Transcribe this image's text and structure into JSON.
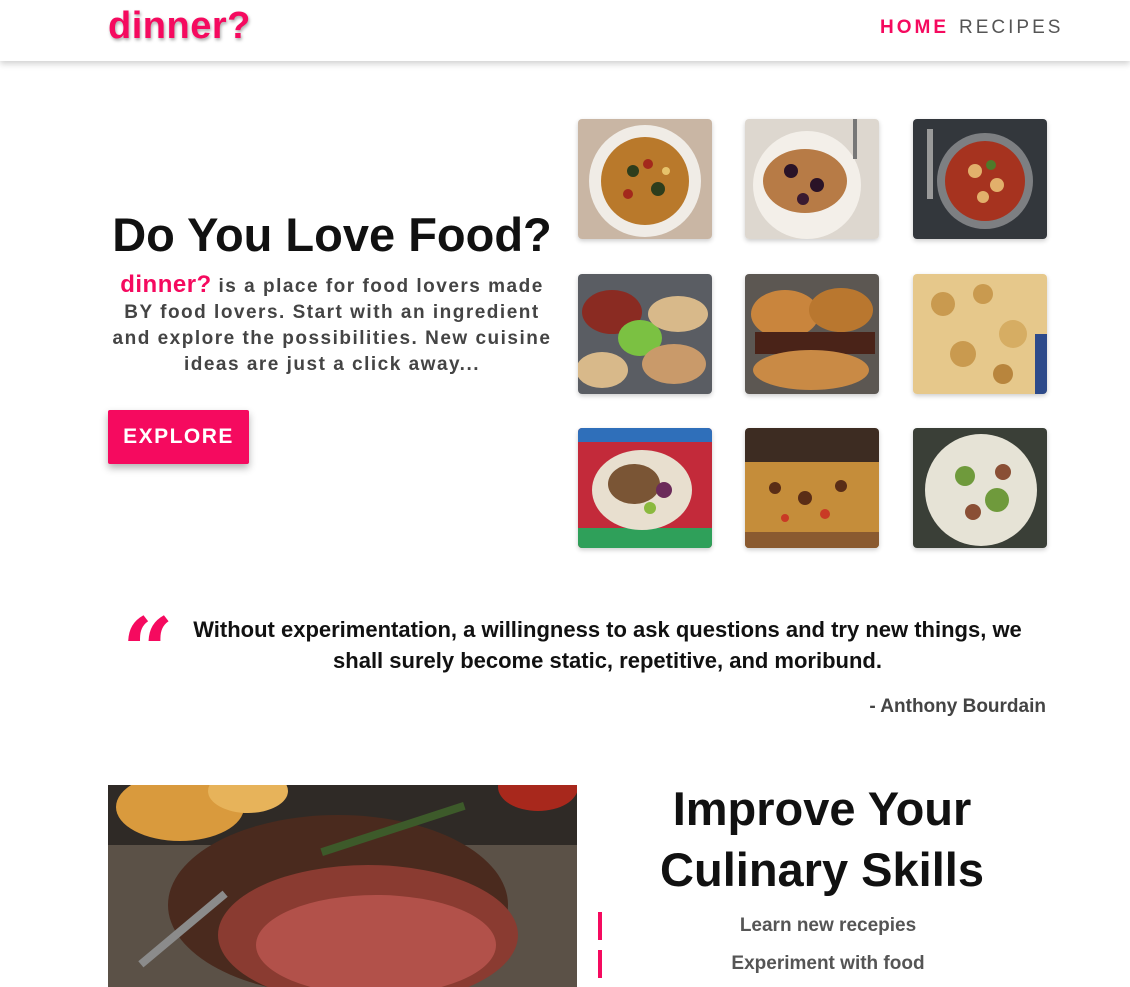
{
  "nav": {
    "brand": "dinner?",
    "links": [
      {
        "label": "HOME",
        "active": true
      },
      {
        "label": "RECIPES",
        "active": false
      }
    ]
  },
  "hero": {
    "title": "Do You Love Food?",
    "brand": "dinner?",
    "text": "is a place for food lovers made BY food lovers. Start with an ingredient and explore the possibilities. New cuisine ideas are just a click away...",
    "cta": "EXPLORE"
  },
  "quote": {
    "icon": "quote-icon",
    "text": "Without experimentation, a willingness to ask questions and try new things, we shall surely become static, repetitive, and moribund.",
    "author": "- Anthony Bourdain"
  },
  "skills": {
    "title": "Improve Your Culinary Skills",
    "items": [
      "Learn new recepies",
      "Experiment with food"
    ]
  },
  "colors": {
    "accent": "#f50a5f",
    "text": "#111111",
    "muted": "#555555"
  }
}
